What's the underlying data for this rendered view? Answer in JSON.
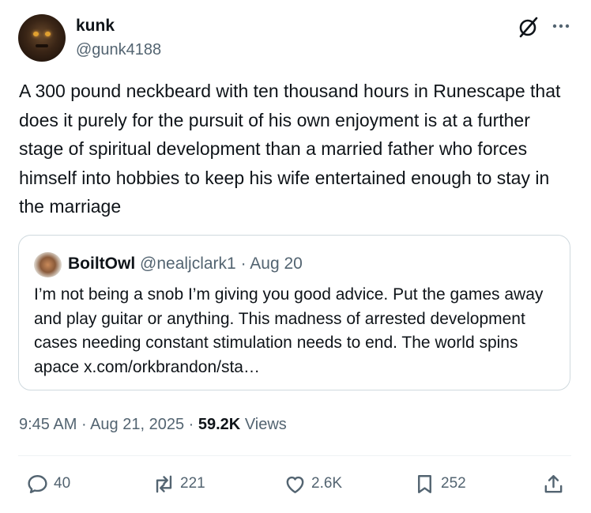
{
  "author": {
    "name": "kunk",
    "handle": "@gunk4188"
  },
  "header_icons": [
    "grok-icon",
    "more-icon"
  ],
  "tweet": {
    "text": "A 300 pound neckbeard with ten thousand hours in Runescape that does it purely for the pursuit of his own enjoyment is at a further stage of spiritual development than a married father who forces himself into hobbies to keep his wife entertained enough to stay in the marriage"
  },
  "quote": {
    "name": "BoiltOwl",
    "handle": "@nealjclark1",
    "separator": "·",
    "date": "Aug 20",
    "text": "I’m not being a snob I’m giving you good advice. Put the games away and play guitar or anything. This madness of arrested development cases needing constant stimulation needs to end. The world spins apace x.com/orkbrandon/sta…"
  },
  "meta": {
    "time": "9:45 AM",
    "separator": "·",
    "date": "Aug 21, 2025",
    "views_count": "59.2K",
    "views_label": "Views"
  },
  "actions": {
    "replies": "40",
    "reposts": "221",
    "likes": "2.6K",
    "bookmarks": "252"
  },
  "colors": {
    "text": "#0f1419",
    "secondary": "#536471",
    "border": "#cfd9de"
  }
}
